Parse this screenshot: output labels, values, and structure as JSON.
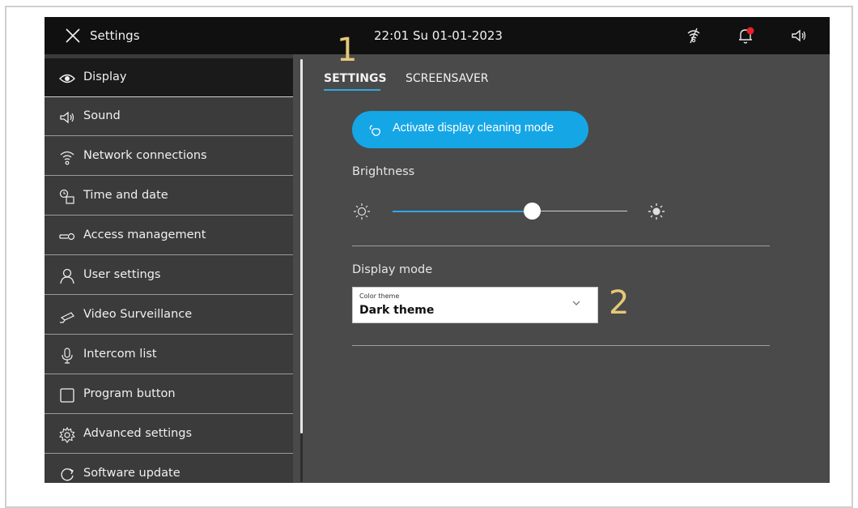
{
  "topbar": {
    "title": "Settings",
    "clock": "22:01  Su 01-01-2023"
  },
  "sidebar": {
    "items": [
      {
        "label": "Display",
        "icon": "eye-icon"
      },
      {
        "label": "Sound",
        "icon": "speaker-icon"
      },
      {
        "label": "Network connections",
        "icon": "wifi-icon"
      },
      {
        "label": "Time and date",
        "icon": "clock-calendar-icon"
      },
      {
        "label": "Access  management",
        "icon": "key-icon"
      },
      {
        "label": "User settings",
        "icon": "user-icon"
      },
      {
        "label": "Video Surveillance",
        "icon": "camera-icon"
      },
      {
        "label": "Intercom list",
        "icon": "microphone-icon"
      },
      {
        "label": "Program button",
        "icon": "square-button-icon"
      },
      {
        "label": "Advanced settings",
        "icon": "gear-icon"
      },
      {
        "label": "Software update",
        "icon": "refresh-icon"
      }
    ]
  },
  "tabs": {
    "settings": "SETTINGS",
    "screensaver": "SCREENSAVER"
  },
  "cleaning_button": {
    "label": "Activate display cleaning mode"
  },
  "brightness": {
    "label": "Brightness",
    "level_percent": 60
  },
  "display_mode": {
    "label": "Display mode",
    "select_caption": "Color theme",
    "select_value": "Dark theme"
  },
  "annotations": {
    "marker_1": "1",
    "marker_2": "2"
  },
  "colors": {
    "accent": "#15a6e6",
    "notification_dot": "#e8202a",
    "marker": "#e6c878"
  }
}
